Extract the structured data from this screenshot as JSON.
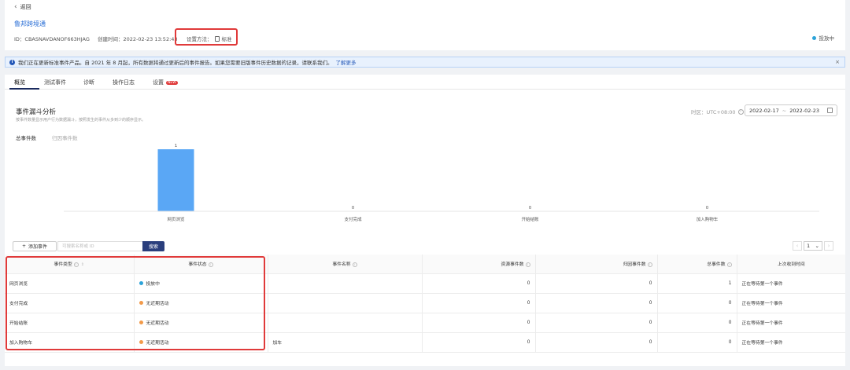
{
  "header": {
    "back_label": "返回",
    "pixel_name": "鲁邦跨境通",
    "id_text": "ID：CBASNAVDANOF663HJAG",
    "created_text": "创建时间：2022-02-23 13:52:43",
    "method_label": "设置方法：",
    "method_value": "标准",
    "status": "投放中"
  },
  "notice": {
    "text": "我们正在更新标准事件产品。自 2021 年 8 月起，所有数据将通过更新后的事件报告。如果您需要旧版事件历史数据的记录，请联系我们。",
    "link": "了解更多",
    "close": "×"
  },
  "tabs": [
    "概览",
    "测试事件",
    "诊断",
    "操作日志",
    "设置"
  ],
  "new_badge": "NEW",
  "overview": {
    "title": "事件漏斗分析",
    "subtitle": "按事件数量显示用户行为数据漏斗，按照发生的事件从多到少的顺序显示。",
    "timezone": "时区：UTC+08:00",
    "date_start": "2022-02-17",
    "date_sep": "~",
    "date_end": "2022-02-23",
    "chart_tab_total": "总事件数",
    "chart_tab_return": "归因事件数"
  },
  "chart_data": {
    "type": "bar",
    "categories": [
      "网页浏览",
      "支付完成",
      "开始结账",
      "加入购物车"
    ],
    "values": [
      1,
      0,
      0,
      0
    ],
    "ylim": [
      0,
      1
    ],
    "grid": false,
    "colors": [
      "#5aa7f5"
    ]
  },
  "toolbar": {
    "add_event": "添加事件",
    "search_placeholder": "可搜索名称或 ID",
    "search_button": "搜索",
    "page": "1"
  },
  "table": {
    "columns": [
      "事件类型",
      "事件状态",
      "事件名称",
      "资源事件数",
      "归因事件数",
      "总事件数",
      "上次收到时间"
    ],
    "rows": [
      {
        "type": "网页浏览",
        "status": "投放中",
        "status_color": "blue",
        "name": "",
        "resource": "0",
        "attributed": "0",
        "total": "1",
        "last": "正在等待第一个事件"
      },
      {
        "type": "支付完成",
        "status": "无近期活动",
        "status_color": "orange",
        "name": "",
        "resource": "0",
        "attributed": "0",
        "total": "0",
        "last": "正在等待第一个事件"
      },
      {
        "type": "开始结账",
        "status": "无近期活动",
        "status_color": "orange",
        "name": "",
        "resource": "0",
        "attributed": "0",
        "total": "0",
        "last": "正在等待第一个事件"
      },
      {
        "type": "加入购物车",
        "status": "无近期活动",
        "status_color": "orange",
        "name": "加车",
        "resource": "0",
        "attributed": "0",
        "total": "0",
        "last": "正在等待第一个事件"
      }
    ]
  }
}
